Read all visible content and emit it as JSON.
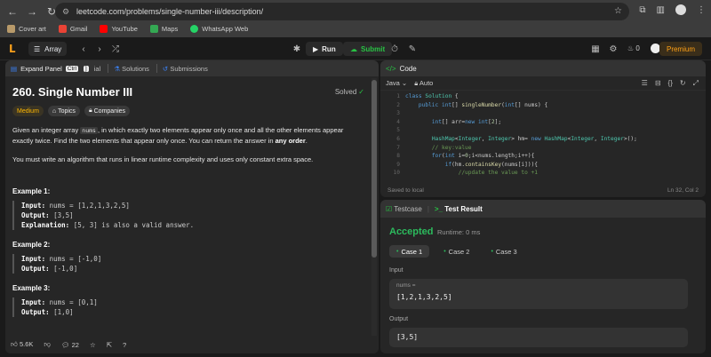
{
  "browser": {
    "url": "leetcode.com/problems/single-number-iii/description/",
    "bookmarks": [
      {
        "label": "Cover art",
        "color": "#b89a6a"
      },
      {
        "label": "Gmail",
        "color": "#ea4335"
      },
      {
        "label": "YouTube",
        "color": "#ff0000"
      },
      {
        "label": "Maps",
        "color": "#34a853"
      },
      {
        "label": "WhatsApp Web",
        "color": "#25d366"
      }
    ]
  },
  "topbar": {
    "problem_list": "Array",
    "run": "Run",
    "submit": "Submit",
    "streak": "0",
    "premium": "Premium"
  },
  "left_tabs": {
    "expand": "Expand Panel",
    "kbd1": "Ctrl",
    "kbd2": "]",
    "truncated": "ial",
    "solutions": "Solutions",
    "submissions": "Submissions"
  },
  "problem": {
    "title": "260. Single Number III",
    "status": "Solved",
    "difficulty": "Medium",
    "topics": "Topics",
    "companies": "Companies",
    "desc_p1_a": "Given an integer array ",
    "desc_p1_code": "nums",
    "desc_p1_b": ", in which exactly two elements appear only once and all the other elements appear exactly twice. Find the two elements that appear only once. You can return the answer in ",
    "desc_p1_bold": "any order",
    "desc_p1_end": ".",
    "desc_p2": "You must write an algorithm that runs in linear runtime complexity and uses only constant extra space.",
    "examples": [
      {
        "heading": "Example 1:",
        "input": "nums = [1,2,1,3,2,5]",
        "output": "[3,5]",
        "explanation": "[5, 3] is also a valid answer."
      },
      {
        "heading": "Example 2:",
        "input": "nums = [-1,0]",
        "output": "[-1,0]"
      },
      {
        "heading": "Example 3:",
        "input": "nums = [0,1]",
        "output": "[1,0]"
      }
    ],
    "labels": {
      "input": "Input:",
      "output": "Output:",
      "explanation": "Explanation:"
    }
  },
  "footer": {
    "likes": "5.6K",
    "comments": "22"
  },
  "code": {
    "title": "Code",
    "language": "Java",
    "mode": "Auto",
    "saved": "Saved to local",
    "position": "Ln 32, Col 2",
    "lines": [
      {
        "n": "1",
        "text": "class Solution {"
      },
      {
        "n": "2",
        "text": "    public int[] singleNumber(int[] nums) {"
      },
      {
        "n": "3",
        "text": ""
      },
      {
        "n": "4",
        "text": "        int[] arr=new int[2];"
      },
      {
        "n": "5",
        "text": ""
      },
      {
        "n": "6",
        "text": "        HashMap<Integer, Integer> hm= new HashMap<Integer, Integer>();"
      },
      {
        "n": "7",
        "text": "        // key:value"
      },
      {
        "n": "8",
        "text": "        for(int i=0;i<nums.length;i++){"
      },
      {
        "n": "9",
        "text": "            if(hm.containsKey(nums[i])){"
      },
      {
        "n": "10",
        "text": "                //update the value to +1"
      }
    ]
  },
  "result": {
    "tab_testcase": "Testcase",
    "tab_result": "Test Result",
    "status": "Accepted",
    "runtime": "Runtime: 0 ms",
    "cases": [
      "Case 1",
      "Case 2",
      "Case 3"
    ],
    "input_label": "Input",
    "input_var": "nums =",
    "input_value": "[1,2,1,3,2,5]",
    "output_label": "Output",
    "output_value": "[3,5]"
  }
}
